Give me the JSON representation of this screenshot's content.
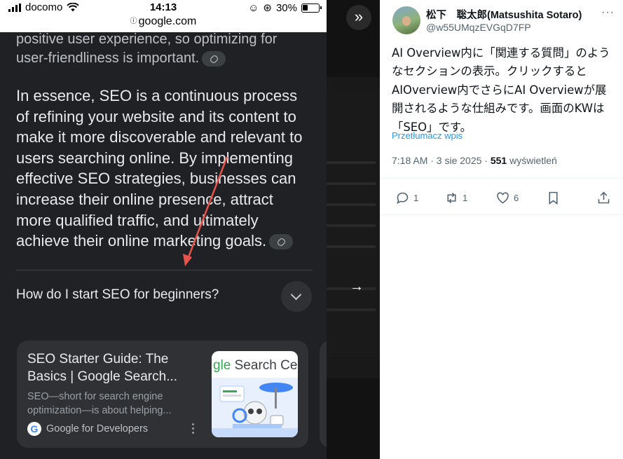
{
  "status_bar": {
    "carrier": "docomo",
    "time": "14:13",
    "url": "google.com",
    "battery": "30%"
  },
  "ai_overview": {
    "paragraph_partial": "positive user experience, so optimizing for user-friendliness is important.",
    "paragraph_essence": "In essence, SEO is a continuous process of refining your website and its content to make it more discoverable and relevant to users searching online. By implementing effective SEO strategies, businesses can increase their online presence, attract more qualified traffic, and ultimately achieve their online marketing goals.",
    "related_question": "How do I start SEO for beginners?"
  },
  "source_card": {
    "title": "SEO Starter Guide: The Basics | Google Search...",
    "snippet": "SEO—short for search engine optimization—is about helping...",
    "source": "Google for Developers",
    "thumbnail_text_g": "gle",
    "thumbnail_text_rest": " Search Cen"
  },
  "tweet": {
    "display_name": "松下　聡太郎(Matsushita Sotaro)",
    "handle": "@w55UMqzEVGqD7FP",
    "more": "···",
    "body": "AI Overview内に「関連する質問」のようなセクションの表示。クリックするとAIOverview内でさらにAI Overviewが展開されるような仕組みです。画面のKWは「SEO」です。",
    "translate_link": "Przetłumacz wpis",
    "time": "7:18 AM · 3 sie 2025 · ",
    "views_count": "551",
    "views_label": " wyświetleń",
    "replies": "1",
    "reposts": "1",
    "likes": "6"
  },
  "colors": {
    "annotation_arrow": "#e5534b",
    "link_blue": "#1d9bf0"
  }
}
